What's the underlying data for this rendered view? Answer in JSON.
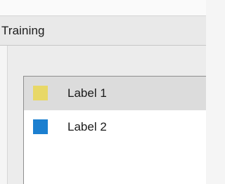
{
  "header": {
    "title": "Training"
  },
  "labels_list": {
    "items": [
      {
        "label": "Label 1",
        "color": "#e8d867",
        "icon": "color-swatch",
        "selected": true
      },
      {
        "label": "Label 2",
        "color": "#1b7fd0",
        "icon": "color-swatch",
        "selected": false
      }
    ]
  }
}
